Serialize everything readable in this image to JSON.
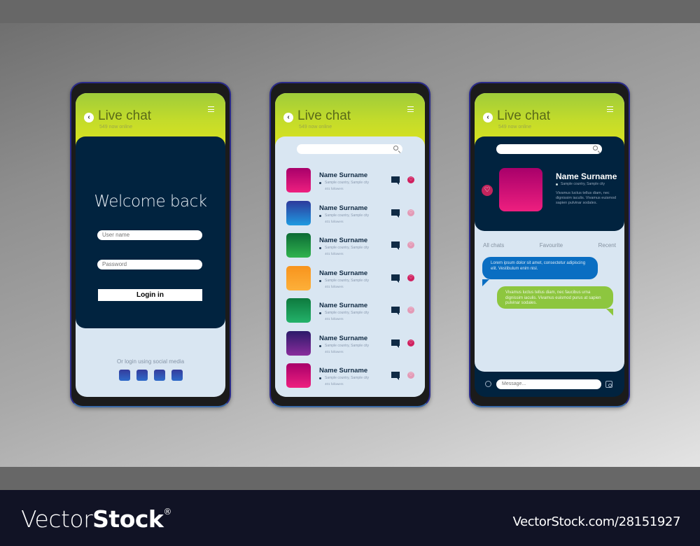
{
  "watermark": {
    "brand_light": "Vector",
    "brand_bold": "Stock",
    "registered": "®",
    "image_id": "VectorStock.com/28151927"
  },
  "header": {
    "title": "Live chat",
    "subtitle": "549 now online",
    "back_icon": "chevron-left-icon",
    "menu_icon": "hamburger-menu-icon"
  },
  "login": {
    "heading": "Welcome back",
    "username_placeholder": "User name",
    "password_placeholder": "Password",
    "login_label": "Login in",
    "social_label": "Or login using social media",
    "social_buttons": 4,
    "social_color": "#2e5fc0"
  },
  "contacts": {
    "search_placeholder": "",
    "items": [
      {
        "name": "Name Surname",
        "location": "Sample country, Sample city",
        "followers": "401 followers",
        "color_top": "#a8006a",
        "color_bottom": "#ee1f7f",
        "favourite": true
      },
      {
        "name": "Name Surname",
        "location": "Sample country, Sample city",
        "followers": "401 followers",
        "color_top": "#2d3a9c",
        "color_bottom": "#1f9ae0",
        "favourite": false
      },
      {
        "name": "Name Surname",
        "location": "Sample country, Sample city",
        "followers": "401 followers",
        "color_top": "#0d6b35",
        "color_bottom": "#2fb34e",
        "favourite": false
      },
      {
        "name": "Name Surname",
        "location": "Sample country, Sample city",
        "followers": "401 followers",
        "color_top": "#f8941d",
        "color_bottom": "#fdb03a",
        "favourite": true
      },
      {
        "name": "Name Surname",
        "location": "Sample country, Sample city",
        "followers": "401 followers",
        "color_top": "#0e7a3e",
        "color_bottom": "#23b26a",
        "favourite": false
      },
      {
        "name": "Name Surname",
        "location": "Sample country, Sample city",
        "followers": "401 followers",
        "color_top": "#2c1a6a",
        "color_bottom": "#8a2c9c",
        "favourite": true
      },
      {
        "name": "Name Surname",
        "location": "Sample country, Sample city",
        "followers": "401 followers",
        "color_top": "#a8006a",
        "color_bottom": "#ee1f7f",
        "favourite": false
      }
    ]
  },
  "profile": {
    "name": "Name Surname",
    "location": "Sample country, Sample city",
    "bio": "Vivamus luctus tellus diam, nec dignissim iaculis. Vivamus euismod sapien pulvinar sodales.",
    "tabs": [
      "All chats",
      "Favourite",
      "Recent"
    ],
    "messages": [
      {
        "side": "left",
        "color": "#0a6ec2",
        "text": "Lorem ipsum dolor sit amet, consectetur adipiscing elit. Vestibulum enim nisl."
      },
      {
        "side": "right",
        "color": "#8dc63f",
        "text": "Vivamus luctus tellus diam, nec faucibus urna dignissim iaculis. Vivamus euismod purus at sapien pulvinar sodales."
      }
    ],
    "message_placeholder": "Message..."
  },
  "colors": {
    "header_green": "#b8d62e",
    "navy": "#01233f",
    "panel": "#d9e6f2",
    "heart": "#d0205f"
  }
}
